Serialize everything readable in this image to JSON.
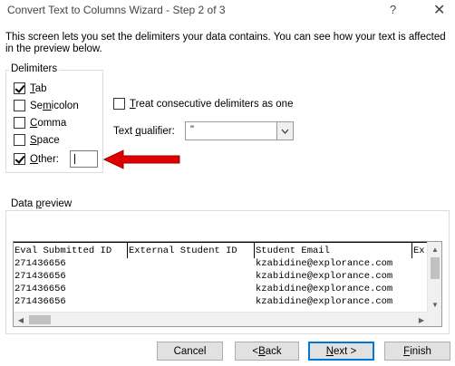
{
  "window": {
    "title": "Convert Text to Columns Wizard - Step 2 of 3",
    "help_glyph": "?",
    "close_glyph": "✕"
  },
  "intro": "This screen lets you set the delimiters your data contains.  You can see how your text is affected in the preview below.",
  "delimiters": {
    "group_label": "Delimiters",
    "tab": {
      "pre": "",
      "key": "T",
      "post": "ab",
      "checked": true
    },
    "semicolon": {
      "pre": "Se",
      "key": "m",
      "post": "icolon",
      "checked": false
    },
    "comma": {
      "pre": "",
      "key": "C",
      "post": "omma",
      "checked": false
    },
    "space": {
      "pre": "",
      "key": "S",
      "post": "pace",
      "checked": false
    },
    "other": {
      "pre": "",
      "key": "O",
      "post": "ther:",
      "checked": true,
      "value": ""
    }
  },
  "consecutive": {
    "pre": "",
    "key": "T",
    "post": "reat consecutive delimiters as one",
    "checked": false
  },
  "text_qualifier": {
    "pre": "Text ",
    "key": "q",
    "post": "ualifier:",
    "value": "\""
  },
  "preview": {
    "group_pre": "Data ",
    "group_key": "p",
    "group_post": "review",
    "columns": [
      "Eval Submitted ID",
      "External Student ID",
      "Student Email",
      "Ex"
    ],
    "rows": [
      [
        "271436656",
        "",
        "kzabidine@explorance.com",
        ""
      ],
      [
        "271436656",
        "",
        "kzabidine@explorance.com",
        ""
      ],
      [
        "271436656",
        "",
        "kzabidine@explorance.com",
        ""
      ],
      [
        "271436656",
        "",
        "kzabidine@explorance.com",
        ""
      ]
    ]
  },
  "buttons": {
    "cancel": {
      "pre": "Cancel",
      "key": "",
      "post": ""
    },
    "back": {
      "pre": "< ",
      "key": "B",
      "post": "ack"
    },
    "next": {
      "pre": "",
      "key": "N",
      "post": "ext >"
    },
    "finish": {
      "pre": "",
      "key": "F",
      "post": "inish"
    }
  },
  "colors": {
    "arrow": "#e00000",
    "primary_border": "#0078d7",
    "button_face": "#e1e1e1"
  }
}
